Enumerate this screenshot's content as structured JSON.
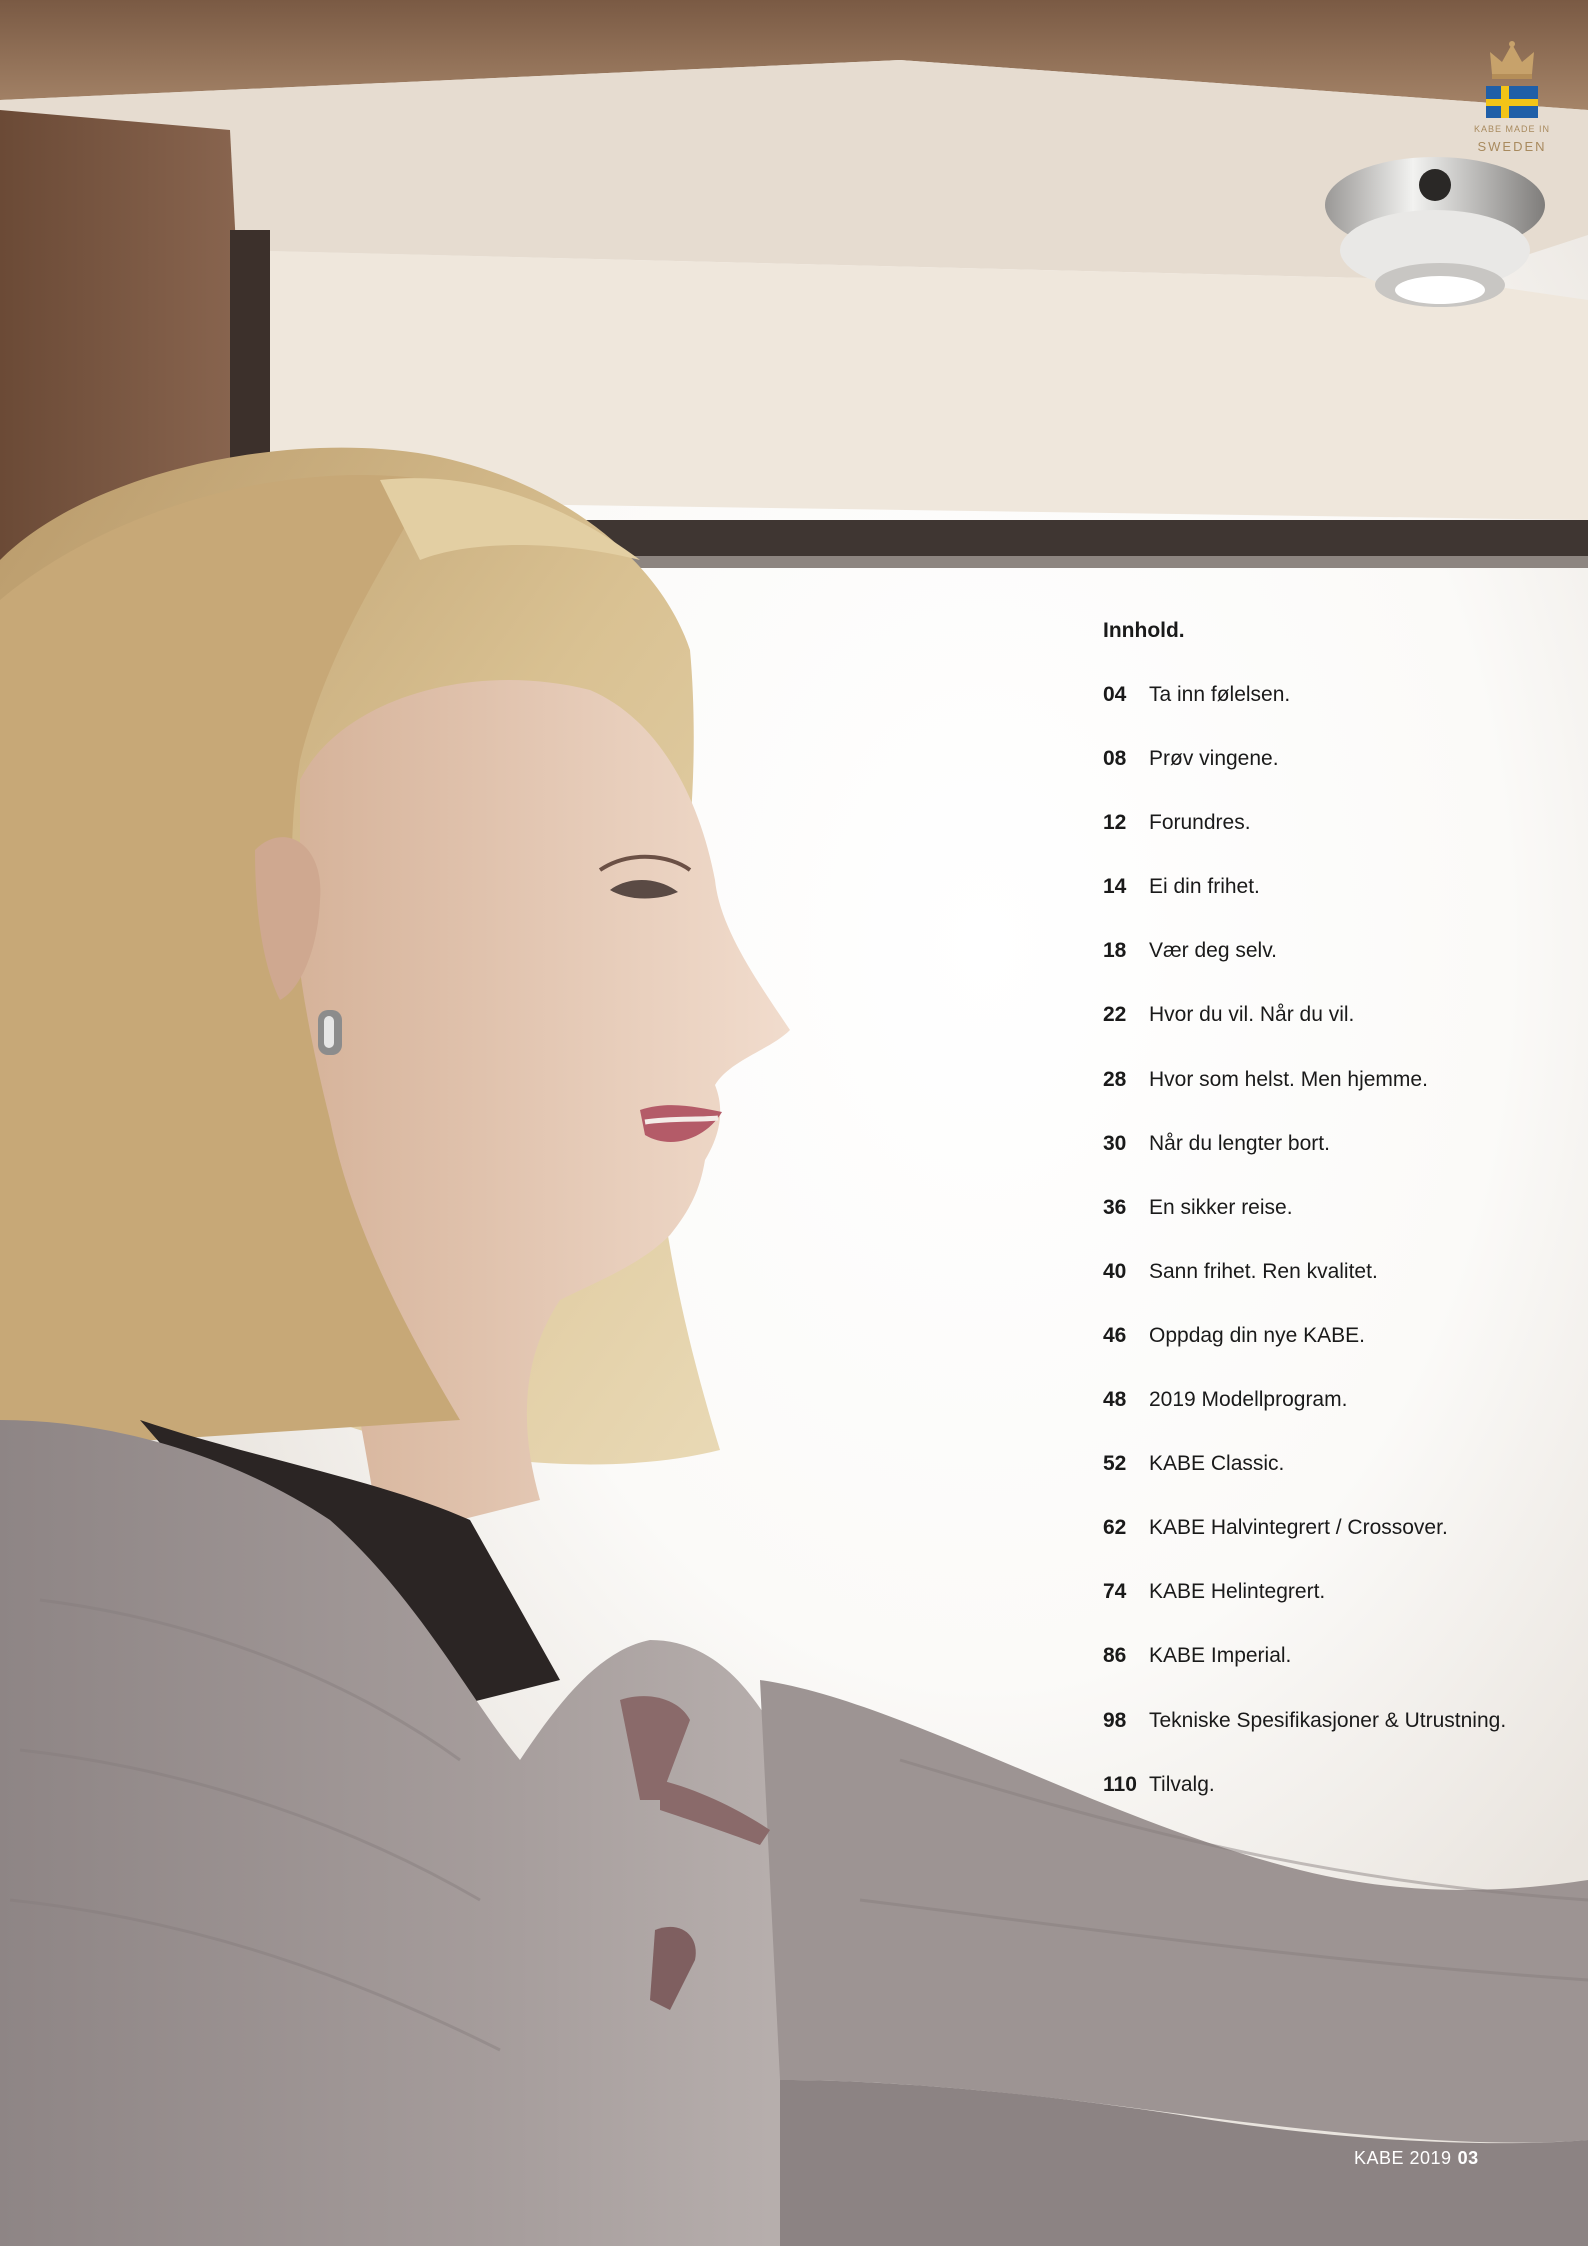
{
  "badge": {
    "made_text": "KABE MADE IN",
    "country": "SWEDEN",
    "icons": [
      "crown-icon",
      "swedish-flag-icon"
    ]
  },
  "toc": {
    "title": "Innhold.",
    "items": [
      {
        "page": "04",
        "label": "Ta inn følelsen."
      },
      {
        "page": "08",
        "label": "Prøv vingene."
      },
      {
        "page": "12",
        "label": "Forundres."
      },
      {
        "page": "14",
        "label": "Ei din frihet."
      },
      {
        "page": "18",
        "label": "Vær deg selv."
      },
      {
        "page": "22",
        "label": "Hvor du vil. Når du vil."
      },
      {
        "page": "28",
        "label": "Hvor som helst. Men hjemme."
      },
      {
        "page": "30",
        "label": "Når du lengter bort."
      },
      {
        "page": "36",
        "label": "En sikker reise."
      },
      {
        "page": "40",
        "label": "Sann frihet. Ren kvalitet."
      },
      {
        "page": "46",
        "label": "Oppdag din nye KABE."
      },
      {
        "page": "48",
        "label": "2019 Modellprogram."
      },
      {
        "page": "52",
        "label": "KABE Classic."
      },
      {
        "page": "62",
        "label": "KABE Halvintegrert / Crossover."
      },
      {
        "page": "74",
        "label": "KABE Helintegrert."
      },
      {
        "page": "86",
        "label": "KABE Imperial."
      },
      {
        "page": "98",
        "label": "Tekniske Spesifikasjoner & Utrustning."
      },
      {
        "page": "110",
        "label": "Tilvalg."
      }
    ]
  },
  "footer": {
    "brand_year": "KABE 2019",
    "page_number": "03"
  }
}
